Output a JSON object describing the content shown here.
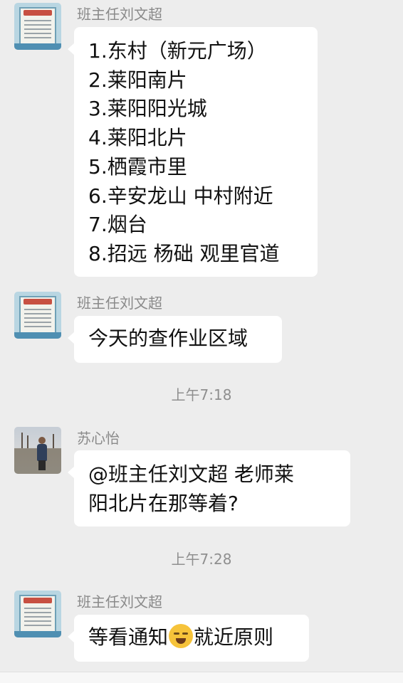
{
  "messages": [
    {
      "sender": "班主任刘文超",
      "avatar": "poster-avatar",
      "lines": [
        "1.东村（新元广场）",
        "2.莱阳南片",
        "3.莱阳阳光城",
        "4.莱阳北片",
        "5.栖霞市里",
        "6.辛安龙山 中村附近",
        "7.烟台",
        "8.招远  杨础 观里官道"
      ]
    },
    {
      "sender": "班主任刘文超",
      "avatar": "poster-avatar",
      "lines": [
        "今天的查作业区域"
      ]
    },
    {
      "sender": "苏心怡",
      "avatar": "photo-avatar",
      "lines": [
        "@班主任刘文超  老师莱",
        "阳北片在那等着?"
      ]
    },
    {
      "sender": "班主任刘文超",
      "avatar": "poster-avatar",
      "text_before_emoji": "等看通知",
      "emoji": "crying-laughing-emoji",
      "text_after_emoji": "就近原则"
    }
  ],
  "timestamps": [
    "上午7:18",
    "上午7:28"
  ],
  "colors": {
    "background": "#ededed",
    "bubble": "#ffffff",
    "sender_name": "#8a8a8a",
    "timestamp": "#8f8f8f"
  }
}
